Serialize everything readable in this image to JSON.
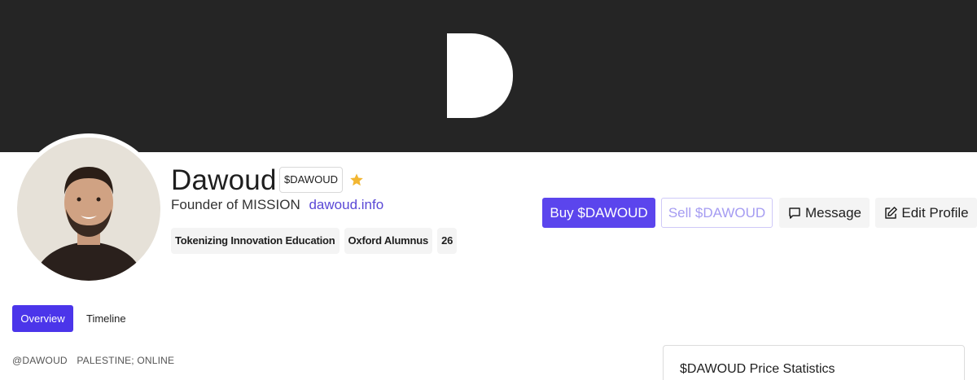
{
  "profile": {
    "name": "Dawoud",
    "ticker": "$DAWOUD",
    "title": "Founder of MISSION",
    "website": "dawoud.info",
    "tags": [
      "Tokenizing Innovation Education",
      "Oxford Alumnus",
      "26"
    ],
    "handle": "@DAWOUD",
    "location": "PALESTINE; ONLINE"
  },
  "actions": {
    "buy_label": "Buy $DAWOUD",
    "sell_label": "Sell $DAWOUD",
    "message_label": "Message",
    "edit_label": "Edit Profile"
  },
  "tabs": [
    {
      "label": "Overview",
      "active": true
    },
    {
      "label": "Timeline",
      "active": false
    }
  ],
  "stats": {
    "title": "$DAWOUD Price Statistics"
  },
  "icons": {
    "banner_logo": "d-logo-icon",
    "favorite": "star-icon",
    "message": "chat-bubble-icon",
    "edit": "edit-icon"
  },
  "colors": {
    "accent": "#5b45ed",
    "banner": "#252525",
    "star": "#f2b631"
  }
}
